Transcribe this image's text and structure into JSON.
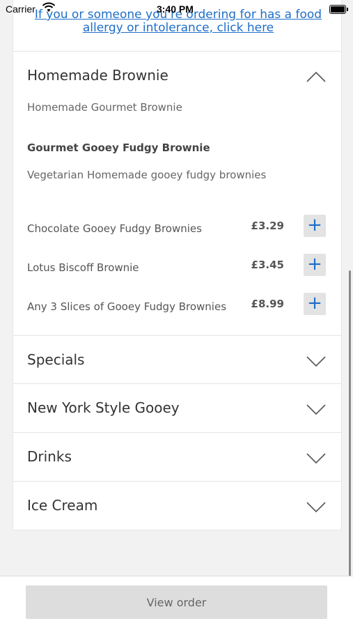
{
  "status_bar": {
    "carrier": "Carrier",
    "time": "3:40 PM"
  },
  "allergy_link": "If you or someone you're ordering for has a food allergy or intolerance, click here",
  "expanded_section": {
    "title": "Homemade Brownie",
    "subtitle": "Homemade Gourmet Brownie",
    "group_title": "Gourmet Gooey Fudgy Brownie",
    "group_description": "Vegetarian Homemade gooey fudgy brownies",
    "items": [
      {
        "name": "Chocolate Gooey Fudgy Brownies",
        "price": "£3.29",
        "add": "+"
      },
      {
        "name": "Lotus Biscoff Brownie",
        "price": "£3.45",
        "add": "+"
      },
      {
        "name": "Any 3 Slices of Gooey Fudgy Brownies",
        "price": "£8.99",
        "add": "+"
      }
    ]
  },
  "collapsed_sections": [
    {
      "title": "Specials"
    },
    {
      "title": "New York Style Gooey"
    },
    {
      "title": "Drinks"
    },
    {
      "title": "Ice Cream"
    }
  ],
  "footer": {
    "view_order_label": "View order"
  },
  "colors": {
    "link": "#1e6ec8",
    "add_button_bg": "#e3e3e3",
    "view_order_bg": "#dddddd"
  },
  "icons": {
    "expanded": "chevron-up-icon",
    "collapsed": "chevron-down-icon",
    "add": "plus-icon"
  }
}
